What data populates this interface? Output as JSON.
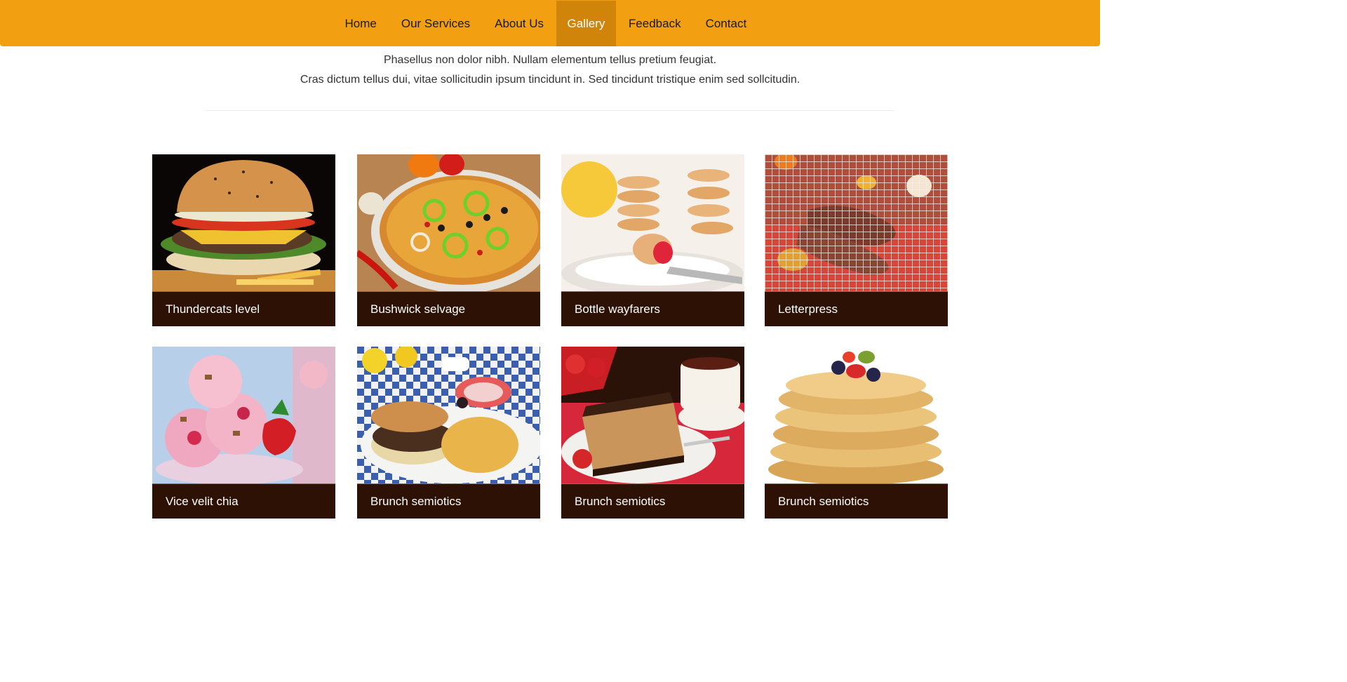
{
  "nav": {
    "items": [
      {
        "label": "Home"
      },
      {
        "label": "Our Services"
      },
      {
        "label": "About Us"
      },
      {
        "label": "Gallery"
      },
      {
        "label": "Feedback"
      },
      {
        "label": "Contact"
      }
    ],
    "active": "Gallery"
  },
  "intro": {
    "line1": "Phasellus non dolor nibh. Nullam elementum tellus pretium feugiat.",
    "line2": "Cras dictum tellus dui, vitae sollicitudin ipsum tincidunt in. Sed tincidunt tristique enim sed sollcitudin."
  },
  "gallery": {
    "items": [
      {
        "caption": "Thundercats level"
      },
      {
        "caption": "Bushwick selvage"
      },
      {
        "caption": "Bottle wayfarers"
      },
      {
        "caption": "Letterpress"
      },
      {
        "caption": "Vice velit chia"
      },
      {
        "caption": "Brunch semiotics"
      },
      {
        "caption": "Brunch semiotics"
      },
      {
        "caption": "Brunch semiotics"
      }
    ]
  },
  "colors": {
    "nav_bg": "#f39f12",
    "nav_active_bg": "#d08409",
    "caption_bg": "#2e1105"
  }
}
